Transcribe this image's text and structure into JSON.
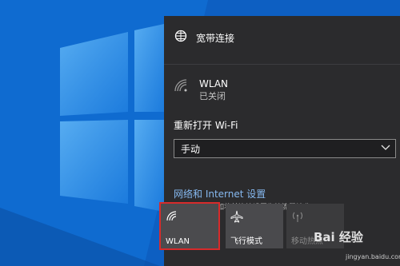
{
  "network_panel": {
    "broadband": {
      "label": "宽带连接",
      "icon": "broadband-globe-icon"
    },
    "wlan": {
      "name": "WLAN",
      "status": "已关闭",
      "icon": "wifi-off-icon"
    },
    "reopen_wifi": {
      "label": "重新打开 Wi-Fi",
      "selected": "手动"
    },
    "settings_link": "网络和 Internet 设置",
    "settings_description": "更改设置，例如将某连接设置为按流量计费。",
    "quick_actions": [
      {
        "label": "WLAN",
        "icon": "wifi-icon",
        "highlighted": true
      },
      {
        "label": "飞行模式",
        "icon": "airplane-icon"
      },
      {
        "label": "移动热点",
        "icon": "hotspot-icon",
        "disabled": true
      }
    ]
  },
  "watermark": {
    "brand": "Bai 经验",
    "url": "jingyan.baidu.com"
  },
  "colors": {
    "panel_bg": "#2b2b2d",
    "tile_bg": "#4a4a4d",
    "link": "#86b9f0",
    "highlight_border": "#d72b2b",
    "desktop_blue": "#1a7bd6"
  }
}
